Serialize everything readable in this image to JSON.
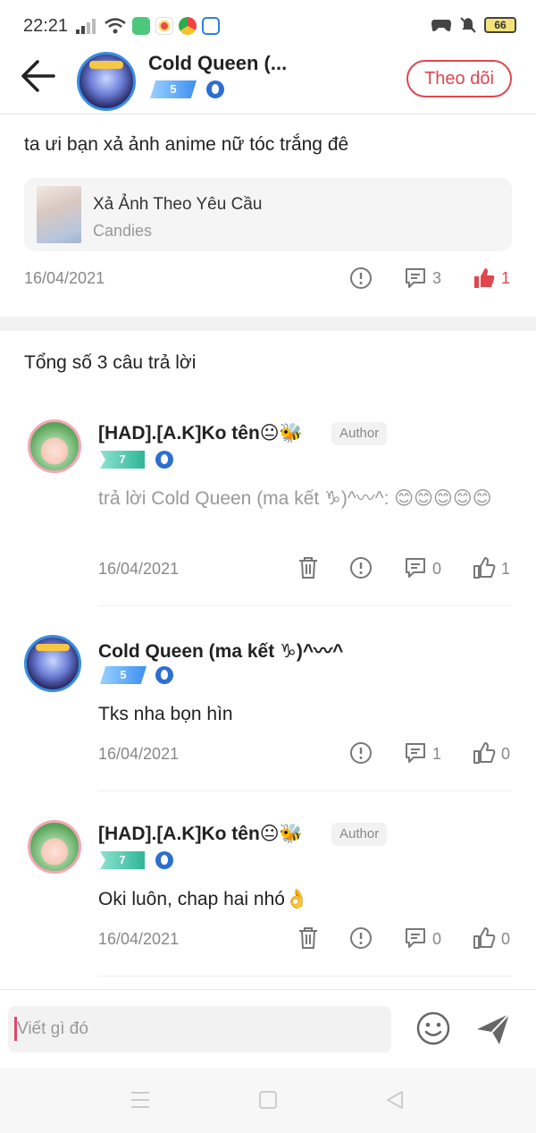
{
  "status_bar": {
    "time": "22:21",
    "battery": "66"
  },
  "header": {
    "name": "Cold Queen (...",
    "level": "5",
    "follow_label": "Theo dõi"
  },
  "question": {
    "text": "ta ưi bạn xả ảnh anime nữ tóc trắng đê",
    "card_title": "Xả Ảnh Theo Yêu Cầu",
    "card_subtitle": "Candies",
    "date": "16/04/2021",
    "comments": "3",
    "likes": "1"
  },
  "total_label": "Tổng số 3 câu trả lời",
  "answers": [
    {
      "name": "[HAD].[A.K]Ko tên😐🐝",
      "tag": "Author",
      "level": "7",
      "body": "trả lời Cold Queen (ma kết ♑)^〰^: 😊😊😊😊😊",
      "date": "16/04/2021",
      "comments": "0",
      "likes": "1"
    },
    {
      "name": "Cold Queen (ma kết ♑)^〰^",
      "level": "5",
      "body": "Tks nha bọn hìn",
      "date": "16/04/2021",
      "comments": "1",
      "likes": "0"
    },
    {
      "name": "[HAD].[A.K]Ko tên😐🐝",
      "tag": "Author",
      "level": "7",
      "body": "Oki luôn, chap hai nhó👌",
      "date": "16/04/2021",
      "comments": "0",
      "likes": "0"
    }
  ],
  "composer": {
    "placeholder": "Viết gì đó"
  },
  "colors": {
    "accent": "#e0464e",
    "level_blue": "#3e8ff0",
    "level_teal": "#2fb597"
  }
}
